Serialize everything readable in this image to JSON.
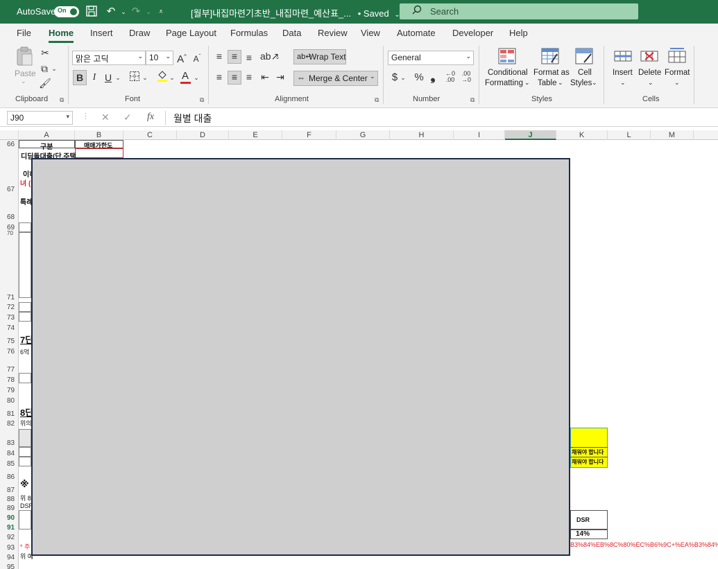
{
  "titlebar": {
    "autosave_label": "AutoSave",
    "autosave_state": "On",
    "document_title": "[월부]내집마련기초반_내집마련_예산표_...",
    "saved_status": "• Saved",
    "search_placeholder": "Search"
  },
  "menu": {
    "tabs": [
      "File",
      "Home",
      "Insert",
      "Draw",
      "Page Layout",
      "Formulas",
      "Data",
      "Review",
      "View",
      "Automate",
      "Developer",
      "Help"
    ],
    "active": "Home"
  },
  "ribbon": {
    "clipboard": {
      "label": "Clipboard",
      "paste": "Paste"
    },
    "font": {
      "label": "Font",
      "name": "맑은 고딕",
      "size": "10",
      "bold": "B",
      "italic": "I",
      "underline": "U"
    },
    "alignment": {
      "label": "Alignment",
      "wrap_text": "Wrap Text",
      "merge_center": "Merge & Center"
    },
    "number": {
      "label": "Number",
      "format": "General",
      "currency": "$",
      "percent": "%",
      "comma": "❟"
    },
    "styles": {
      "label": "Styles",
      "conditional_1": "Conditional",
      "conditional_2": "Formatting",
      "format_as_1": "Format as",
      "format_as_2": "Table",
      "cell_styles_1": "Cell",
      "cell_styles_2": "Styles"
    },
    "cells": {
      "label": "Cells",
      "insert": "Insert",
      "delete": "Delete",
      "format": "Format"
    }
  },
  "formula_bar": {
    "name_box": "J90",
    "fx": "fx",
    "value": "월별 대출"
  },
  "grid": {
    "columns": [
      "A",
      "B",
      "C",
      "D",
      "E",
      "F",
      "G",
      "H",
      "I",
      "J",
      "K",
      "L",
      "M"
    ],
    "selected_column": "J",
    "rows": [
      "66",
      "67",
      "68",
      "69",
      "70",
      "71",
      "72",
      "73",
      "74",
      "75",
      "76",
      "77",
      "78",
      "79",
      "80",
      "81",
      "82",
      "83",
      "84",
      "85",
      "86",
      "87",
      "88",
      "89",
      "90",
      "91",
      "92",
      "93",
      "94",
      "95"
    ],
    "selected_rows": [
      "90",
      "91"
    ],
    "cells": {
      "a66": "구분",
      "b66": "매매가한도",
      "a67_1": "디딤돌대출(단,주택",
      "a67_2": "이하",
      "a67_3": "녀 (",
      "a68": "특례",
      "a75": "7단",
      "a76": "6억",
      "a81": "8단",
      "a82": "위의",
      "a87": "※",
      "a88": "위 8",
      "a89": "DSR",
      "a93": "* 주",
      "a94": "위 예",
      "k84": "채워야 합니다",
      "k85": "채워야 합니다",
      "k90": "DSR",
      "k92": "14%",
      "k93": "B3%84%EB%8C%80%EC%B6%9C+%EA%B3%84%"
    }
  },
  "colors": {
    "excel_green": "#217346",
    "overlay": "#d0cfd0",
    "highlight_yellow": "#ffff00",
    "red_text": "#e0242b"
  }
}
